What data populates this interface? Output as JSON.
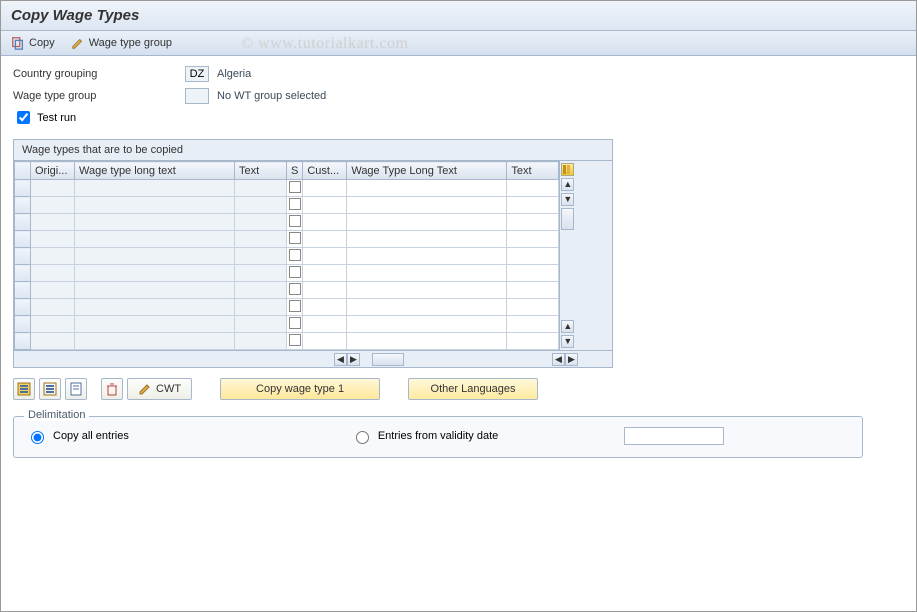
{
  "title": "Copy Wage Types",
  "toolbar": {
    "copy_label": "Copy",
    "wt_group_label": "Wage type group"
  },
  "watermark": "© www.tutorialkart.com",
  "form": {
    "country_grouping_label": "Country grouping",
    "country_grouping_value": "DZ",
    "country_grouping_text": "Algeria",
    "wt_group_label": "Wage type group",
    "wt_group_value": "",
    "wt_group_text": "No WT group selected",
    "test_run_label": "Test run",
    "test_run_checked": true
  },
  "grid": {
    "caption": "Wage types that are to be copied",
    "columns_left": [
      "Origi...",
      "Wage type long text",
      "Text"
    ],
    "columns_right": [
      "S",
      "Cust...",
      "Wage Type Long Text",
      "Text"
    ],
    "row_count": 10
  },
  "buttons": {
    "cwt_label": "CWT",
    "copy1_label": "Copy wage type 1",
    "other_lang_label": "Other Languages"
  },
  "delimitation": {
    "title": "Delimitation",
    "option_all": "Copy all entries",
    "option_from_date": "Entries from validity date",
    "selected": "all",
    "date_value": ""
  }
}
